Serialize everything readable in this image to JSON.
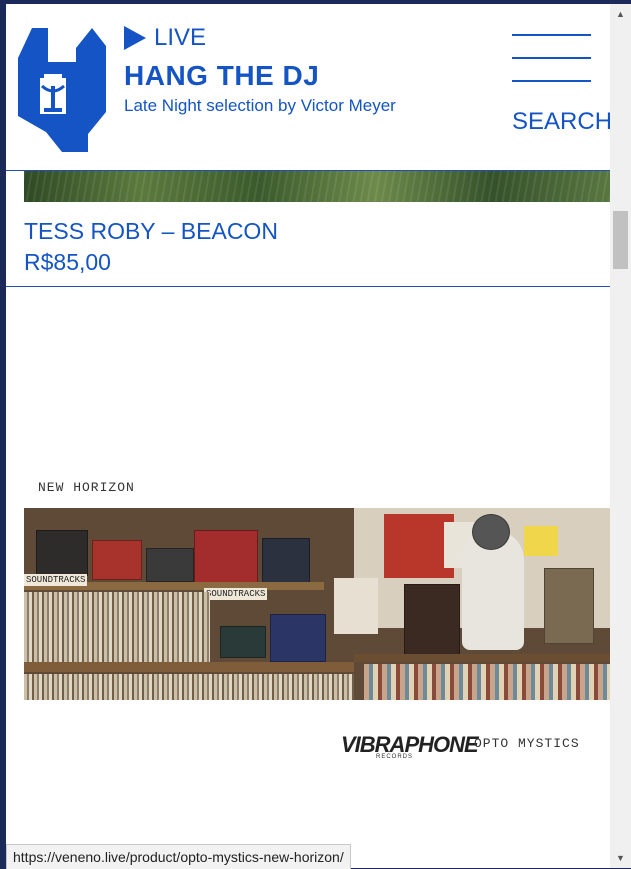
{
  "header": {
    "live_label": "LIVE",
    "name": "HANG THE DJ",
    "subtitle": "Late Night selection by Victor Meyer",
    "search_label": "SEARCH"
  },
  "product": {
    "title": "TESS ROBY – BEACON",
    "price": "R$85,00"
  },
  "album": {
    "cover_title": "NEW HORIZON",
    "label_logo": "VIBRAPHONE",
    "label_logo_sub": "RECORDS",
    "artist_text": "OPTO MYSTICS",
    "shelf_labels": [
      "SOUNDTRACKS",
      "SOUNDTRACKS"
    ]
  },
  "statusbar": {
    "url": "https://veneno.live/product/opto-mystics-new-horizon/"
  },
  "colors": {
    "brand_blue": "#1454c4"
  }
}
